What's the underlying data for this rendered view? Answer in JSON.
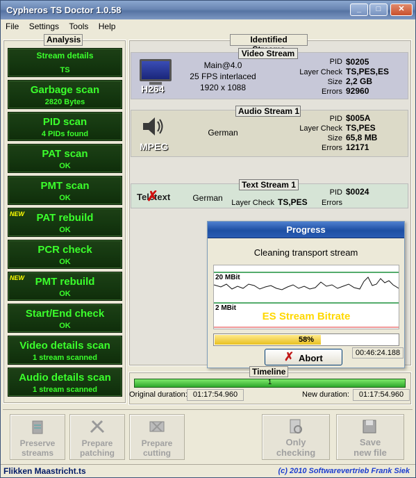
{
  "window": {
    "title": "Cypheros TS Doctor 1.0.58",
    "min": "_",
    "max": "□",
    "close": "✕"
  },
  "menu": [
    "File",
    "Settings",
    "Tools",
    "Help"
  ],
  "analysis": {
    "label": "Analysis",
    "buttons": [
      {
        "title": "Stream details",
        "sub": "TS",
        "new": ""
      },
      {
        "title": "Garbage scan",
        "sub": "2820 Bytes",
        "new": ""
      },
      {
        "title": "PID scan",
        "sub": "4 PIDs found",
        "new": ""
      },
      {
        "title": "PAT scan",
        "sub": "OK",
        "new": ""
      },
      {
        "title": "PMT scan",
        "sub": "OK",
        "new": ""
      },
      {
        "title": "PAT rebuild",
        "sub": "OK",
        "new": "NEW"
      },
      {
        "title": "PCR check",
        "sub": "OK",
        "new": ""
      },
      {
        "title": "PMT rebuild",
        "sub": "OK",
        "new": "NEW"
      },
      {
        "title": "Start/End check",
        "sub": "OK",
        "new": ""
      },
      {
        "title": "Video details scan",
        "sub": "1 stream scanned",
        "new": ""
      },
      {
        "title": "Audio details scan",
        "sub": "1 stream scanned",
        "new": ""
      }
    ]
  },
  "streams": {
    "label": "Identified Streams",
    "video": {
      "header": "Video Stream",
      "codec": "H264",
      "line1": "Main@4.0",
      "line2": "25 FPS interlaced",
      "line3": "1920 x 1088",
      "pid_label": "PID",
      "pid": "$0205",
      "layer_label": "Layer Check",
      "layer": "TS,PES,ES",
      "size_label": "Size",
      "size": "2,2 GB",
      "errors_label": "Errors",
      "errors": "92960"
    },
    "audio": {
      "header": "Audio Stream 1",
      "codec": "MPEG",
      "language": "German",
      "pid_label": "PID",
      "pid": "$005A",
      "layer_label": "Layer Check",
      "layer": "TS,PES",
      "size_label": "Size",
      "size": "65,8 MB",
      "errors_label": "Errors",
      "errors": "12171"
    },
    "text": {
      "header": "Text Stream 1",
      "codec": "Teletext",
      "language": "German",
      "pid_label": "PID",
      "pid": "$0024",
      "layer_label": "Layer Check",
      "layer": "TS,PES",
      "errors_label": "Errors",
      "errors": ""
    }
  },
  "progress": {
    "title": "Progress",
    "message": "Cleaning transport stream",
    "graph_top": "20 MBit",
    "graph_bottom": "2 MBit",
    "graph_caption": "ES Stream Bitrate",
    "percent": "58%",
    "fraction": 0.58,
    "abort": "Abort",
    "elapsed": "00:46:24.188"
  },
  "timeline": {
    "label": "Timeline",
    "marker": "1",
    "orig_label": "Original duration:",
    "orig": "01:17:54.960",
    "new_label": "New duration:",
    "new": "01:17:54.960"
  },
  "actions": [
    {
      "l1": "Preserve",
      "l2": "streams",
      "icon": "recycle-icon"
    },
    {
      "l1": "Prepare",
      "l2": "patching",
      "icon": "tools-icon"
    },
    {
      "l1": "Prepare",
      "l2": "cutting",
      "icon": "film-cut-icon"
    },
    {
      "l1": "Only",
      "l2": "checking",
      "icon": "check-document-icon"
    },
    {
      "l1": "Save",
      "l2": "new file",
      "icon": "save-file-icon"
    }
  ],
  "status": {
    "file": "Flikken Maastricht.ts",
    "copyright": "(c) 2010 Softwarevertrieb Frank Siek"
  }
}
